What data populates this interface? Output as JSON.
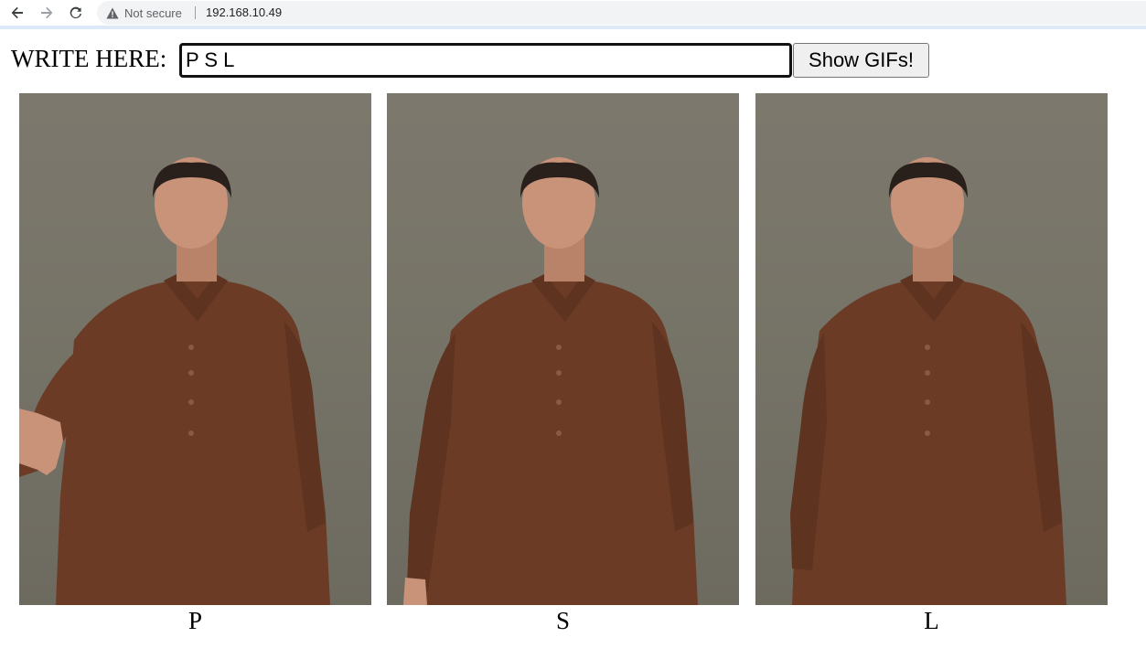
{
  "browser": {
    "security_text": "Not secure",
    "url": "192.168.10.49"
  },
  "form": {
    "label": "WRITE HERE:",
    "input_value": "P S L",
    "button_label": "Show GIFs!"
  },
  "gifs": [
    {
      "letter": "P"
    },
    {
      "letter": "S"
    },
    {
      "letter": "L"
    }
  ],
  "colors": {
    "background_wall": "#77746a",
    "kurta": "#6b3b26",
    "skin": "#c9937a",
    "hair": "#2a201b"
  }
}
